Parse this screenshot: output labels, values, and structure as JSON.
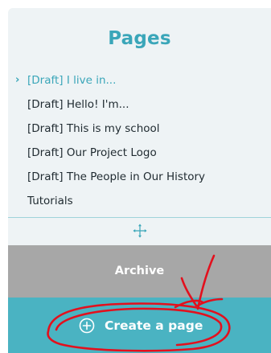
{
  "pages_panel": {
    "title": "Pages",
    "items": [
      {
        "label": "[Draft] I live in...",
        "active": true
      },
      {
        "label": "[Draft] Hello! I'm...",
        "active": false
      },
      {
        "label": "[Draft] This is my school",
        "active": false
      },
      {
        "label": "[Draft] Our Project Logo",
        "active": false
      },
      {
        "label": "[Draft] The People in Our History",
        "active": false
      },
      {
        "label": "Tutorials",
        "active": false
      }
    ],
    "active_indicator": "›"
  },
  "archive_button": {
    "label": "Archive"
  },
  "create_button": {
    "label": "Create a page",
    "icon": "plus-circle-icon"
  },
  "colors": {
    "accent": "#3aa6b9",
    "panel_bg": "#eef3f5",
    "archive_bg": "#a7a7a7",
    "create_bg": "#4ab3c2",
    "annotation": "#e3101d"
  },
  "icons": {
    "move_handle": "move-arrows-icon"
  }
}
